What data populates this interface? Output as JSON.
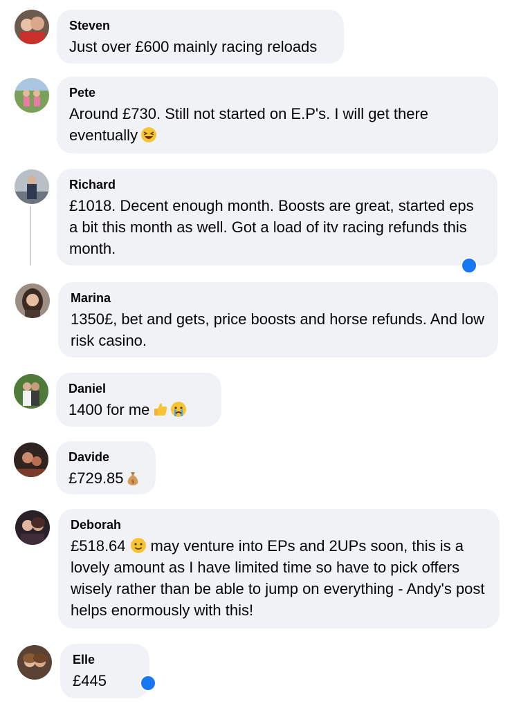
{
  "comments": [
    {
      "name": "Steven",
      "text": "Just over £600 mainly racing reloads"
    },
    {
      "name": "Pete",
      "text": "Around £730. Still not started on E.P's. I will get there eventually"
    },
    {
      "name": "Richard",
      "text": "£1018. Decent enough month. Boosts are great, started eps a bit this month as well. Got a load of itv racing refunds this month."
    },
    {
      "name": "Marina",
      "text": "1350£, bet and gets, price boosts and horse refunds. And low risk casino."
    },
    {
      "name": "Daniel",
      "text": "1400 for me"
    },
    {
      "name": "Davide",
      "text": "£729.85"
    },
    {
      "name": "Deborah",
      "text": "may venture into EPs and 2UPs soon, this is a lovely amount as I have limited time so have to pick offers wisely rather than be able to jump on everything - Andy's post helps enormously with this!",
      "amount": "£518.64"
    },
    {
      "name": "Elle",
      "text": "£445"
    }
  ],
  "icons": {
    "pete_emoji": "laughing-face-icon",
    "daniel_emoji_1": "thumbs-up-icon",
    "daniel_emoji_2": "crying-face-icon",
    "davide_emoji": "money-bag-icon",
    "deborah_emoji": "smiling-face-icon",
    "reaction": "like-reaction-icon"
  },
  "colors": {
    "bubble": "#f0f2f5",
    "reaction": "#1877f2",
    "text": "#050505"
  }
}
